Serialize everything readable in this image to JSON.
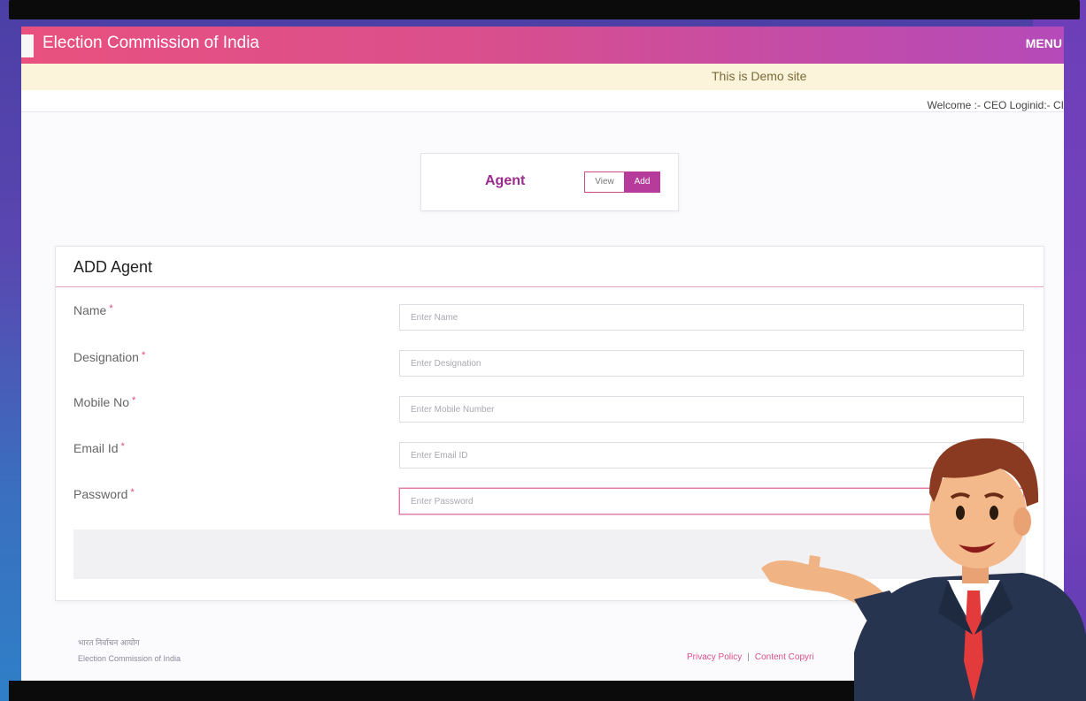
{
  "header": {
    "title": "Election Commission of India",
    "menu_label": "MENU"
  },
  "demo_banner": "This is Demo site",
  "welcome_text": "Welcome :- CEO Loginid:- CI",
  "switcher": {
    "title": "Agent",
    "view_label": "View",
    "add_label": "Add"
  },
  "form": {
    "heading": "ADD Agent",
    "required_mark": "*",
    "fields": [
      {
        "label": "Name",
        "placeholder": "Enter Name"
      },
      {
        "label": "Designation",
        "placeholder": "Enter Designation"
      },
      {
        "label": "Mobile No",
        "placeholder": "Enter Mobile Number"
      },
      {
        "label": "Email Id",
        "placeholder": "Enter Email ID"
      },
      {
        "label": "Password",
        "placeholder": "Enter Password"
      }
    ]
  },
  "footer": {
    "hindi_text": "भारत निर्वाचन आयोग",
    "org_text": "Election Commission of India",
    "privacy_link": "Privacy Policy",
    "separator": "|",
    "content_link": "Content Copyri"
  },
  "colors": {
    "header_start": "#e8517f",
    "header_end": "#b54bb9",
    "accent": "#b63b9b"
  }
}
